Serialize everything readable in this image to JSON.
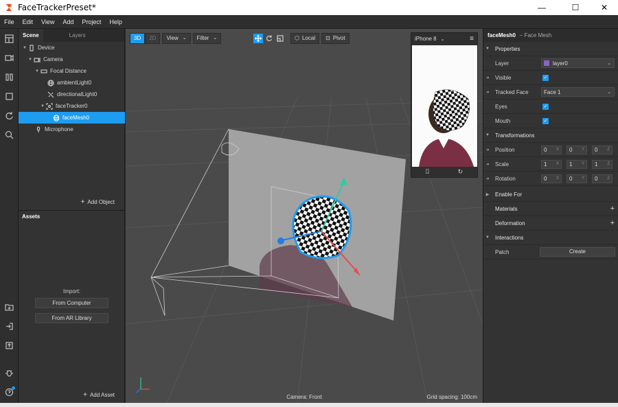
{
  "window": {
    "title": "FaceTrackerPreset*"
  },
  "menu": [
    "File",
    "Edit",
    "View",
    "Add",
    "Project",
    "Help"
  ],
  "scene_panel": {
    "tabs": [
      "Scene",
      "Layers"
    ],
    "tree": [
      {
        "label": "Device",
        "icon": "device-icon",
        "depth": 1,
        "expanded": true
      },
      {
        "label": "Camera",
        "icon": "camera-icon",
        "depth": 2,
        "expanded": true
      },
      {
        "label": "Focal Distance",
        "icon": "focal-distance-icon",
        "depth": 3,
        "expanded": true
      },
      {
        "label": "ambientLight0",
        "icon": "globe-icon",
        "depth": 4
      },
      {
        "label": "directionalLight0",
        "icon": "light-off-icon",
        "depth": 4
      },
      {
        "label": "faceTracker0",
        "icon": "face-tracker-icon",
        "depth": 4,
        "expanded": true
      },
      {
        "label": "faceMesh0",
        "icon": "face-mesh-icon",
        "depth": 5,
        "selected": true
      },
      {
        "label": "Microphone",
        "icon": "microphone-icon",
        "depth": 2
      }
    ],
    "add_object": "Add Object"
  },
  "assets_panel": {
    "title": "Assets",
    "import_label": "Import:",
    "from_computer": "From Computer",
    "from_ar_library": "From AR Library",
    "add_asset": "Add Asset"
  },
  "viewport": {
    "mode_3d": "3D",
    "mode_2d": "2D",
    "view_menu": "View",
    "filter_menu": "Filter",
    "local": "Local",
    "pivot": "Pivot",
    "camera_status": "Camera: Front",
    "grid_status": "Grid spacing: 100cm"
  },
  "simulator": {
    "device": "iPhone 8"
  },
  "inspector": {
    "object_name": "faceMesh0",
    "object_type": "– Face Mesh",
    "properties": "Properties",
    "layer_label": "Layer",
    "layer_value": "layer0",
    "layer_color": "#8a63c9",
    "visible_label": "Visible",
    "tracked_face_label": "Tracked Face",
    "tracked_face_value": "Face 1",
    "eyes_label": "Eyes",
    "mouth_label": "Mouth",
    "transformations": "Transformations",
    "position_label": "Position",
    "position": [
      "0",
      "0",
      "0"
    ],
    "scale_label": "Scale",
    "scale": [
      "1",
      "1",
      "1"
    ],
    "rotation_label": "Rotation",
    "rotation": [
      "0",
      "0",
      "0"
    ],
    "axes": [
      "X",
      "Y",
      "Z"
    ],
    "enable_for": "Enable For",
    "materials": "Materials",
    "deformation": "Deformation",
    "interactions": "Interactions",
    "patch_label": "Patch",
    "create_button": "Create"
  },
  "accent_color": "#1e9cf0"
}
